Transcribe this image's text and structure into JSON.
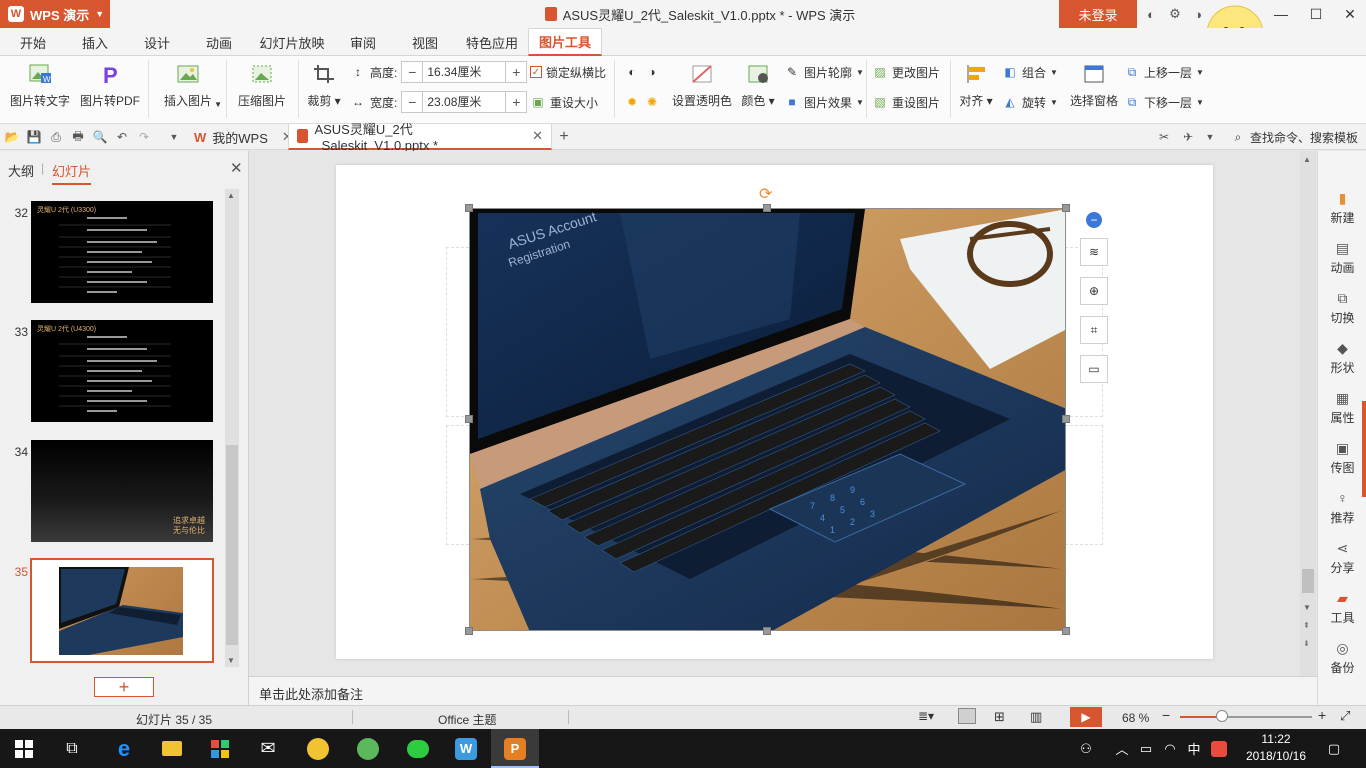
{
  "titlebar": {
    "app_name": "WPS 演示",
    "doc_title": "ASUS灵耀U_2代_Saleskit_V1.0.pptx * - WPS 演示",
    "login": "未登录",
    "ime_char": "中"
  },
  "tabs": [
    "开始",
    "插入",
    "设计",
    "动画",
    "幻灯片放映",
    "审阅",
    "视图",
    "特色应用",
    "图片工具"
  ],
  "active_tab": "图片工具",
  "ribbon": {
    "pic_to_text": "图片转文字",
    "pic_to_pdf": "图片转PDF",
    "insert_pic": "插入图片",
    "compress": "压缩图片",
    "crop": "裁剪",
    "height_label": "高度:",
    "height_value": "16.34厘米",
    "width_label": "宽度:",
    "width_value": "23.08厘米",
    "lock_ratio": "锁定纵横比",
    "reset_size": "重设大小",
    "set_transparent": "设置透明色",
    "color": "颜色",
    "pic_outline": "图片轮廓",
    "pic_effect": "图片效果",
    "change_pic": "更改图片",
    "reset_pic": "重设图片",
    "align": "对齐",
    "group": "组合",
    "rotate": "旋转",
    "selection_pane": "选择窗格",
    "bring_forward": "上移一层",
    "send_backward": "下移一层"
  },
  "qbar": {
    "tab_mywps": "我的WPS",
    "tab_doc": "ASUS灵耀U_2代_Saleskit_V1.0.pptx *",
    "search": "查找命令、搜索模板"
  },
  "leftpanel": {
    "tab_outline": "大纲",
    "tab_slides": "幻灯片",
    "slides": [
      {
        "num": "32",
        "title": "灵耀U 2代 (U3300)"
      },
      {
        "num": "33",
        "title": "灵耀U 2代 (U4300)"
      },
      {
        "num": "34",
        "line1": "追求卓越",
        "line2": "无与伦比"
      },
      {
        "num": "35"
      }
    ],
    "add": "+"
  },
  "notes_placeholder": "单击此处添加备注",
  "rightbar": [
    "新建",
    "动画",
    "切换",
    "形状",
    "属性",
    "传图",
    "推荐",
    "分享",
    "工具",
    "备份"
  ],
  "status": {
    "slide_count": "幻灯片 35 / 35",
    "theme": "Office 主题",
    "zoom": "68 %"
  },
  "taskbar": {
    "time": "11:22",
    "date": "2018/10/16",
    "ime": "中"
  },
  "colors": {
    "accent": "#d7552f",
    "laptop_blue": "#1d3a5c"
  }
}
